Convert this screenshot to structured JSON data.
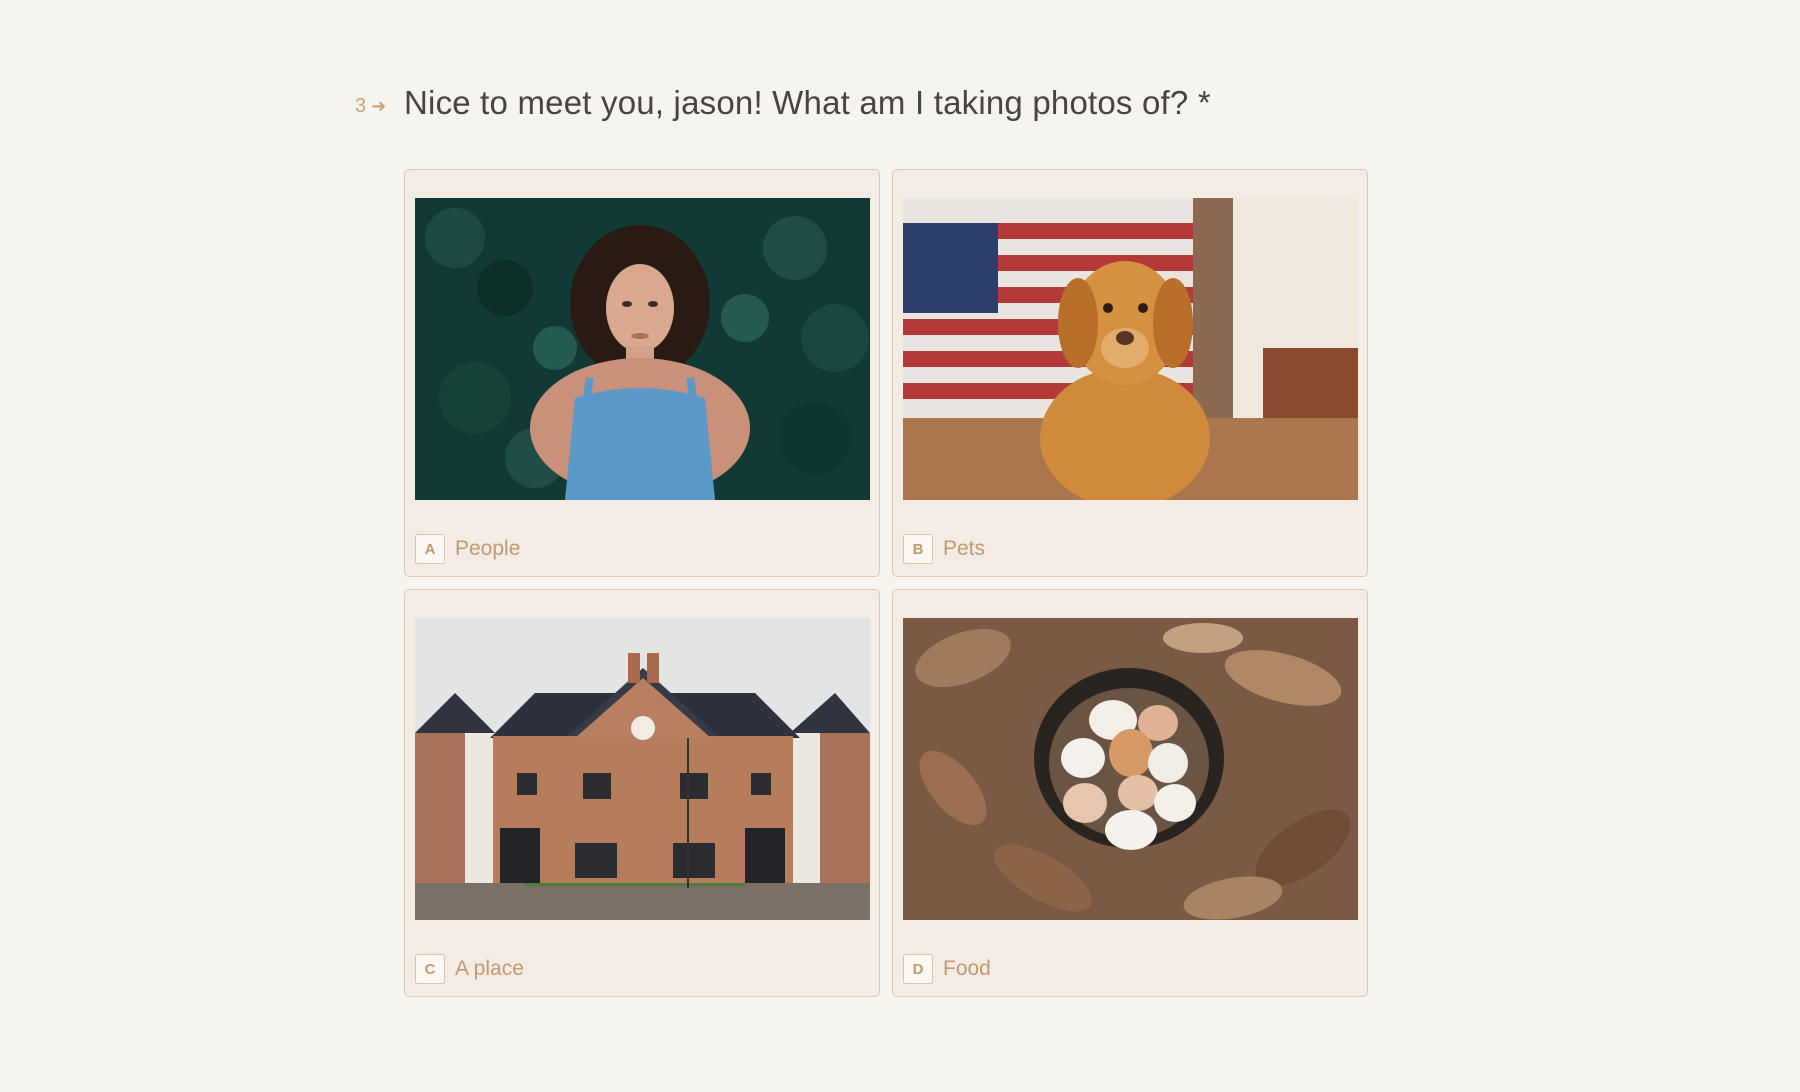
{
  "question": {
    "number": "3",
    "arrow_icon": "arrow-right-icon",
    "text": "Nice to meet you, jason! What am I taking photos of? *"
  },
  "choices": [
    {
      "key": "A",
      "label": "People",
      "image": "woman-in-foliage-photo"
    },
    {
      "key": "B",
      "label": "Pets",
      "image": "golden-retriever-photo"
    },
    {
      "key": "C",
      "label": "A place",
      "image": "brick-house-photo"
    },
    {
      "key": "D",
      "label": "Food",
      "image": "eggs-in-basket-photo"
    }
  ],
  "colors": {
    "background": "#f6f4ef",
    "accent": "#c09a72",
    "card": "#f3ece4",
    "border": "#ddc8b4",
    "question_text": "#4a4440"
  }
}
